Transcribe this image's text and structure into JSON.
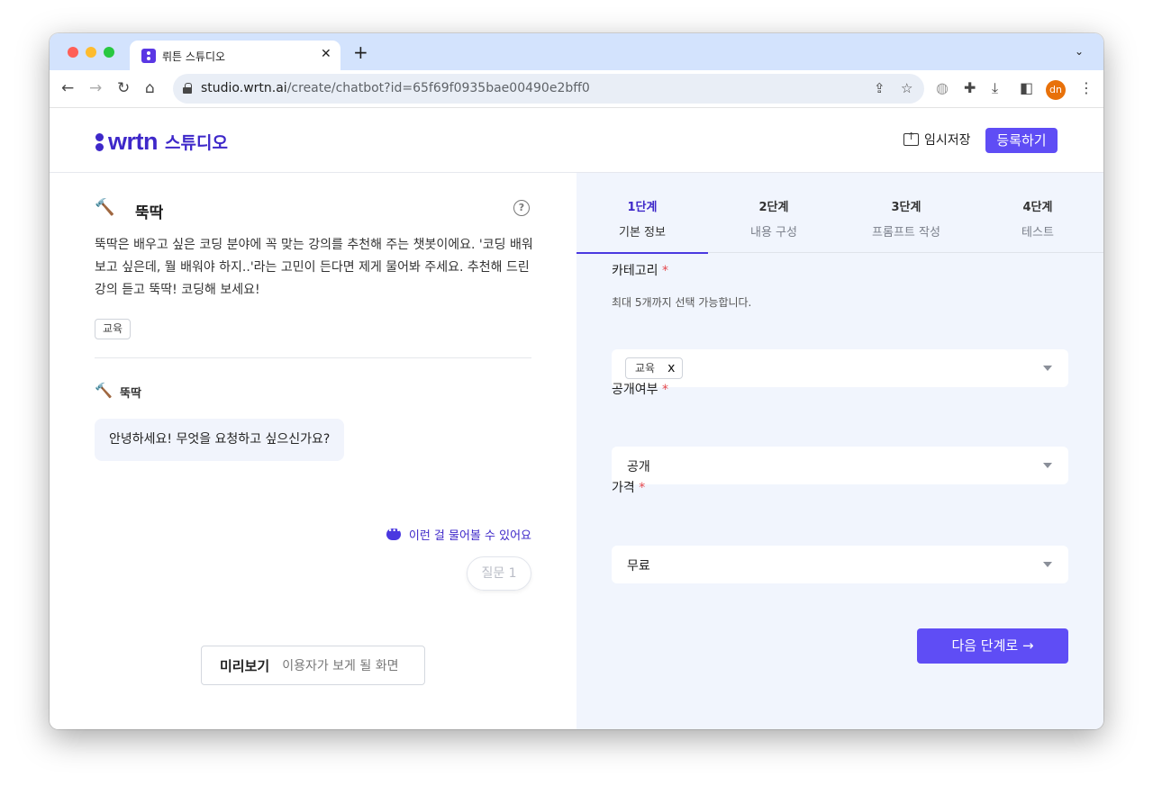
{
  "browser": {
    "tab_title": "뤼튼 스튜디오",
    "tab_close": "✕",
    "new_tab": "+",
    "tab_menu": "⌄",
    "url_host": "studio.wrtn.ai",
    "url_rest": "/create/chatbot?id=65f69f0935bae00490e2bff0",
    "avatar_initials": "dn",
    "avatar_color": "#e8710a"
  },
  "header": {
    "logo_word": "wrtn",
    "logo_sub": "스튜디오",
    "save_draft_label": "임시저장",
    "register_label": "등록하기",
    "brand_color": "#3e28c9",
    "accent_color": "#5f4df5"
  },
  "bot": {
    "icon": "🔨",
    "name": "뚝딱",
    "description": "뚝딱은 배우고 싶은 코딩 분야에 꼭 맞는 강의를 추천해 주는 챗봇이에요. '코딩 배워보고 싶은데, 뭘 배워야 하지..'라는 고민이 든다면 제게 물어봐 주세요. 추천해 드린 강의 듣고 뚝딱! 코딩해 보세요!",
    "tag": "교육",
    "help_icon": "?"
  },
  "chat": {
    "sender": "뚝딱",
    "greeting": "안녕하세요! 무엇을 요청하고 싶으신가요?",
    "suggest_label": "이런 걸 물어볼 수 있어요",
    "question_chip": "질문 1"
  },
  "preview": {
    "title": "미리보기",
    "subtitle": "이용자가 보게 될 화면"
  },
  "steps": [
    {
      "num": "1단계",
      "label": "기본 정보",
      "active": true
    },
    {
      "num": "2단계",
      "label": "내용 구성",
      "active": false
    },
    {
      "num": "3단계",
      "label": "프롬프트 작성",
      "active": false
    },
    {
      "num": "4단계",
      "label": "테스트",
      "active": false
    }
  ],
  "form": {
    "category": {
      "label": "카테고리",
      "required_mark": "*",
      "hint": "최대 5개까지 선택 가능합니다.",
      "selected_chips": [
        "교육"
      ],
      "chip_remove": "x"
    },
    "visibility": {
      "label": "공개여부",
      "required_mark": "*",
      "value": "공개"
    },
    "price": {
      "label": "가격",
      "required_mark": "*",
      "value": "무료"
    },
    "next_button": "다음 단계로 →"
  }
}
